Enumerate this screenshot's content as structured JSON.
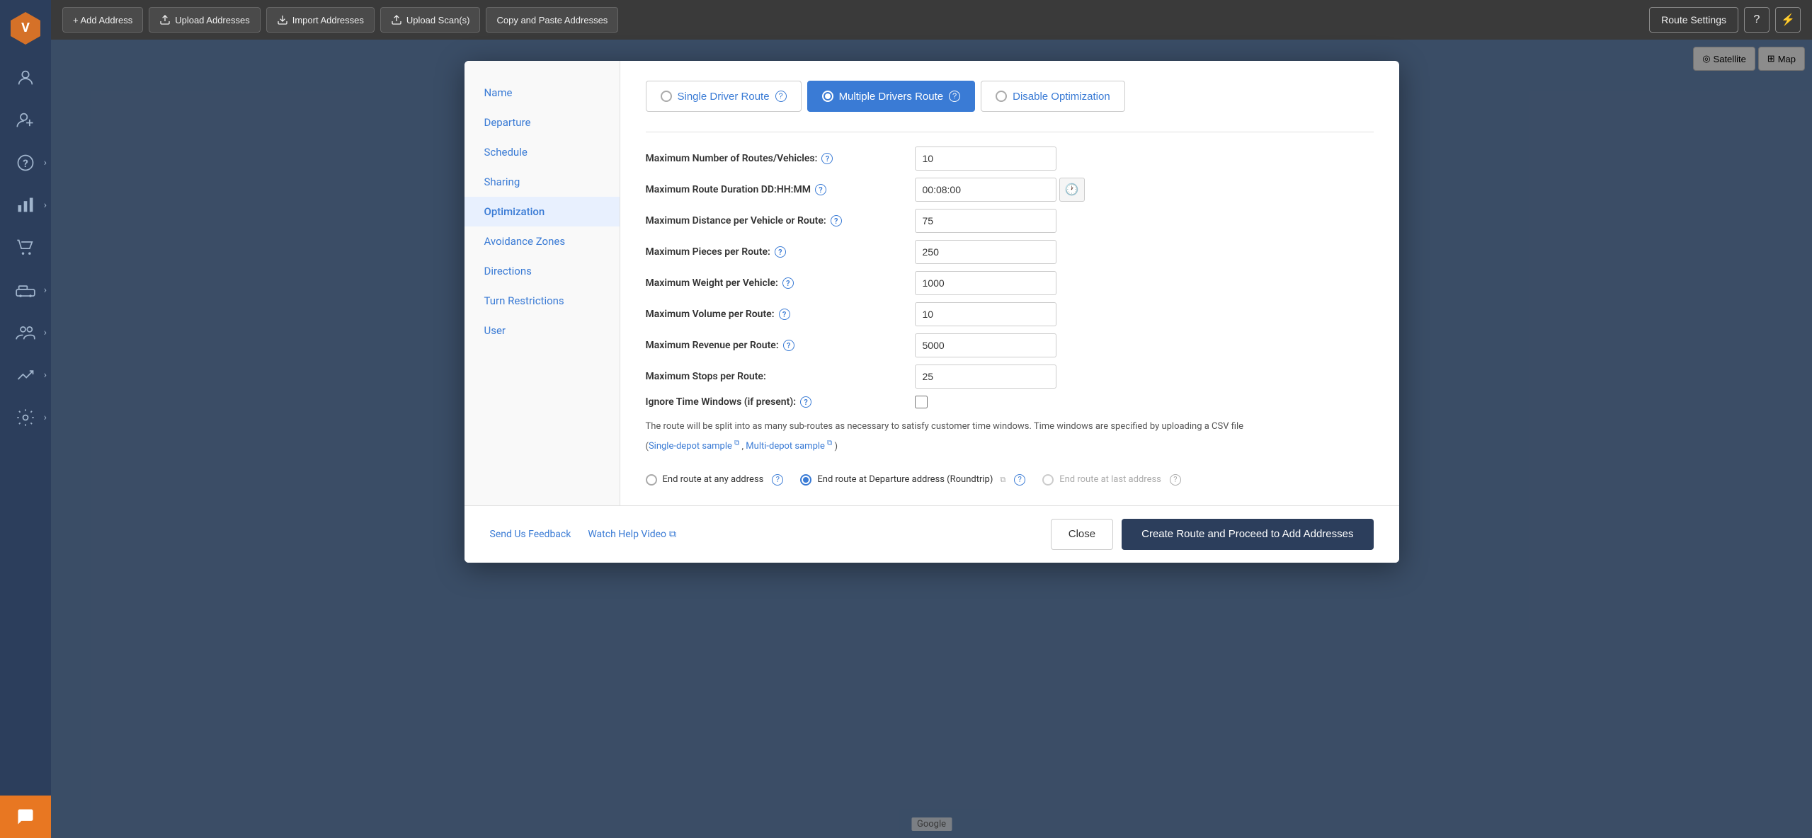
{
  "sidebar": {
    "logo_alt": "Route4Me Logo",
    "items": [
      {
        "name": "user-icon",
        "label": "User"
      },
      {
        "name": "add-user-icon",
        "label": "Add User"
      },
      {
        "name": "help-icon",
        "label": "Help"
      },
      {
        "name": "analytics-icon",
        "label": "Analytics"
      },
      {
        "name": "cart-icon",
        "label": "Cart"
      },
      {
        "name": "fleet-icon",
        "label": "Fleet"
      },
      {
        "name": "team-icon",
        "label": "Team"
      },
      {
        "name": "growth-icon",
        "label": "Growth"
      },
      {
        "name": "settings-icon",
        "label": "Settings"
      }
    ]
  },
  "topbar": {
    "add_address": "+ Add Address",
    "upload_addresses": "Upload Addresses",
    "import_addresses": "Import Addresses",
    "upload_scans": "Upload Scan(s)",
    "copy_paste": "Copy and Paste Addresses",
    "route_settings": "Route Settings"
  },
  "map": {
    "satellite_btn": "Satellite",
    "map_btn": "Map",
    "google_label": "Google"
  },
  "modal": {
    "nav_items": [
      "Name",
      "Departure",
      "Schedule",
      "Sharing",
      "Optimization",
      "Avoidance Zones",
      "Directions",
      "Turn Restrictions",
      "User"
    ],
    "active_nav": "Optimization",
    "route_tabs": [
      {
        "label": "Single Driver Route",
        "id": "single",
        "active": false
      },
      {
        "label": "Multiple Drivers Route",
        "id": "multiple",
        "active": true
      },
      {
        "label": "Disable Optimization",
        "id": "disable",
        "active": false
      }
    ],
    "form_fields": [
      {
        "label": "Maximum Number of Routes/Vehicles:",
        "value": "10",
        "has_help": true,
        "type": "text"
      },
      {
        "label": "Maximum Route Duration DD:HH:MM",
        "value": "00:08:00",
        "has_help": true,
        "type": "duration"
      },
      {
        "label": "Maximum Distance per Vehicle or Route:",
        "value": "75",
        "has_help": true,
        "type": "text"
      },
      {
        "label": "Maximum Pieces per Route:",
        "value": "250",
        "has_help": true,
        "type": "text"
      },
      {
        "label": "Maximum Weight per Vehicle:",
        "value": "1000",
        "has_help": true,
        "type": "text"
      },
      {
        "label": "Maximum Volume per Route:",
        "value": "10",
        "has_help": true,
        "type": "text"
      },
      {
        "label": "Maximum Revenue per Route:",
        "value": "5000",
        "has_help": true,
        "type": "text"
      },
      {
        "label": "Maximum Stops per Route:",
        "value": "25",
        "has_help": false,
        "type": "text"
      },
      {
        "label": "Ignore Time Windows (if present):",
        "value": "",
        "has_help": true,
        "type": "checkbox"
      }
    ],
    "info_text": "The route will be split into as many sub-routes as necessary to satisfy customer time windows. Time windows are specified by uploading a CSV file",
    "single_depot_label": "Single-depot sample",
    "multi_depot_label": "Multi-depot sample",
    "separator": " , ",
    "paren_close": " )",
    "end_route": {
      "options": [
        {
          "label": "End route at any address",
          "checked": false,
          "disabled": false,
          "has_help": true
        },
        {
          "label": "End route at Departure address (Roundtrip)",
          "checked": true,
          "disabled": false,
          "has_help": true
        },
        {
          "label": "End route at last address",
          "checked": false,
          "disabled": true,
          "has_help": true
        }
      ]
    },
    "footer": {
      "send_feedback": "Send Us Feedback",
      "watch_video": "Watch Help Video",
      "close_btn": "Close",
      "create_btn": "Create Route and Proceed to Add Addresses"
    }
  }
}
